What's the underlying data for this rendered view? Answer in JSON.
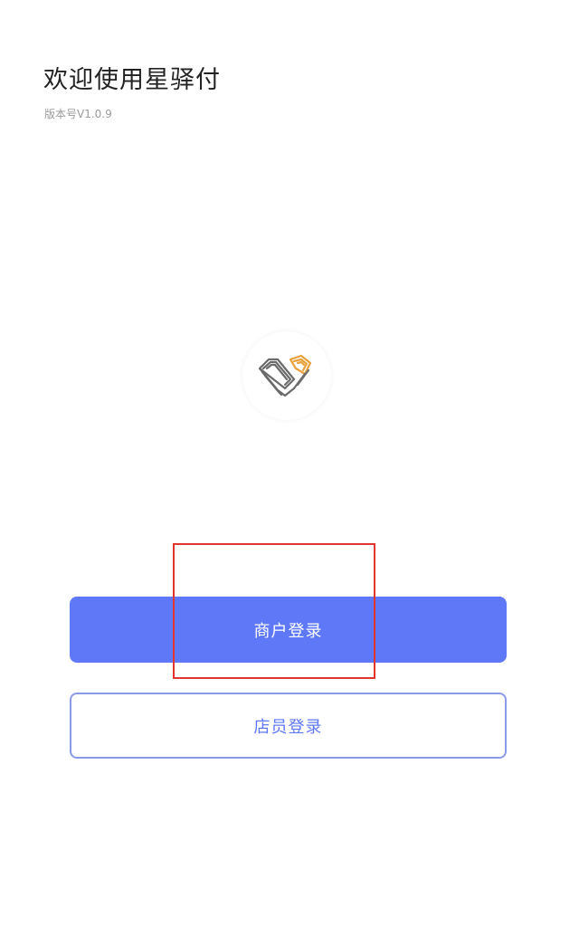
{
  "header": {
    "title": "欢迎使用星驿付",
    "version": "版本号V1.0.9"
  },
  "logo": {
    "icon": "brand-logo-icon",
    "colors": {
      "primary": "#6b6b6b",
      "accent": "#e9a23b"
    }
  },
  "actions": {
    "merchant_login": "商户登录",
    "staff_login": "店员登录"
  },
  "theme": {
    "accent": "#5f78f7",
    "highlight": "#e2352f"
  }
}
